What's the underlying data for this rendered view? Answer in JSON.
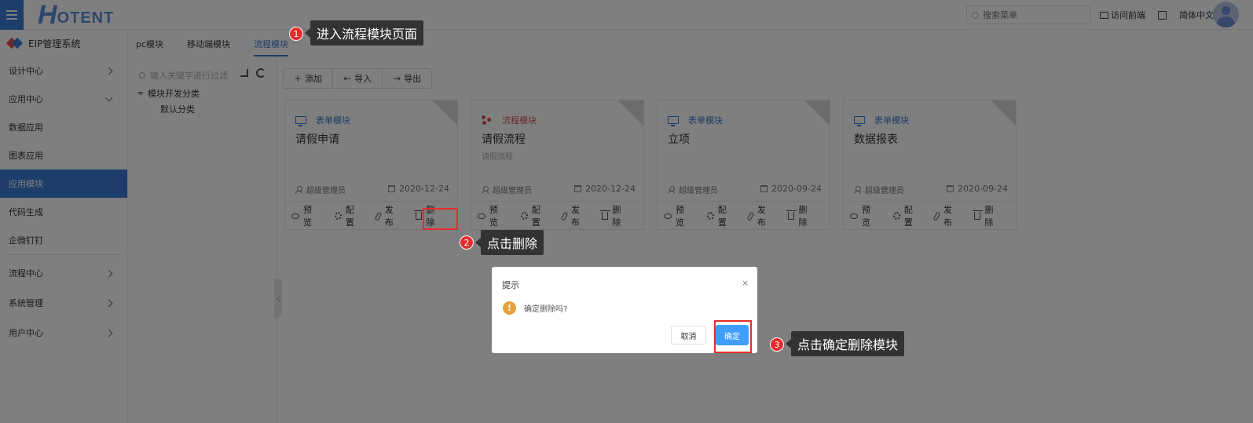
{
  "header": {
    "logo_main": "H",
    "logo_rest": "OTENT",
    "search_placeholder": "搜索菜单",
    "visit_front_label": "访问前端",
    "language_label": "简体中文"
  },
  "sidebar": {
    "system_title": "EIP管理系统",
    "items": [
      {
        "label": "设计中心",
        "type": "group",
        "chevron": "right"
      },
      {
        "label": "应用中心",
        "type": "group",
        "chevron": "down"
      },
      {
        "label": "数据应用",
        "type": "sub"
      },
      {
        "label": "图表应用",
        "type": "sub"
      },
      {
        "label": "应用模块",
        "type": "sub",
        "active": true
      },
      {
        "label": "代码生成",
        "type": "sub"
      },
      {
        "label": "企微钉钉",
        "type": "sub"
      },
      {
        "label": "流程中心",
        "type": "group",
        "chevron": "right"
      },
      {
        "label": "系统管理",
        "type": "group",
        "chevron": "right"
      },
      {
        "label": "用户中心",
        "type": "group",
        "chevron": "right"
      }
    ]
  },
  "tabs": [
    {
      "label": "pc模块",
      "active": false
    },
    {
      "label": "移动端模块",
      "active": false
    },
    {
      "label": "流程模块",
      "active": true
    }
  ],
  "tree": {
    "search_placeholder": "输入关键字进行过滤",
    "root_label": "模块开发分类",
    "child_label": "默认分类"
  },
  "toolbar": {
    "add_label": "添加",
    "import_label": "导入",
    "export_label": "导出"
  },
  "cards": [
    {
      "type_label": "表单模块",
      "type_color": "#3a7bd5",
      "icon": "monitor-icon",
      "name": "请假申请",
      "desc": "",
      "user": "超级管理员",
      "date": "2020-12-24"
    },
    {
      "type_label": "流程模块",
      "type_color": "#d9534f",
      "icon": "flow-icon",
      "name": "请假流程",
      "desc": "请假流程",
      "user": "超级管理员",
      "date": "2020-12-24"
    },
    {
      "type_label": "表单模块",
      "type_color": "#3a7bd5",
      "icon": "monitor-icon",
      "name": "立项",
      "desc": "",
      "user": "超级管理员",
      "date": "2020-09-24"
    },
    {
      "type_label": "表单模块",
      "type_color": "#3a7bd5",
      "icon": "monitor-icon",
      "name": "数据报表",
      "desc": "",
      "user": "超级管理员",
      "date": "2020-09-24"
    }
  ],
  "card_actions": {
    "preview": "预览",
    "config": "配置",
    "publish": "发布",
    "delete": "删除"
  },
  "dialog": {
    "title": "提示",
    "close": "×",
    "message": "确定删除吗?",
    "cancel_label": "取消",
    "ok_label": "确定"
  },
  "annotations": [
    {
      "number": "1",
      "text": "进入流程模块页面"
    },
    {
      "number": "2",
      "text": "点击删除"
    },
    {
      "number": "3",
      "text": "点击确定删除模块"
    }
  ],
  "colors": {
    "primary": "#3a7bd5",
    "highlight": "#e52c2c",
    "warning": "#e6a23c",
    "confirm": "#409eff"
  }
}
